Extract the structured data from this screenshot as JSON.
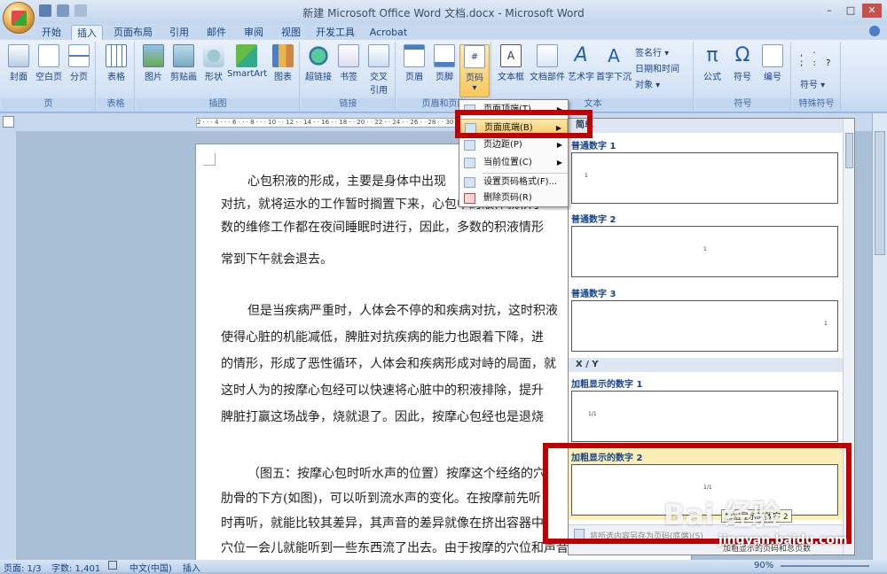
{
  "title": "新建 Microsoft Office Word 文档.docx - Microsoft Word",
  "tabs": [
    "开始",
    "插入",
    "页面布局",
    "引用",
    "邮件",
    "审阅",
    "视图",
    "开发工具",
    "Acrobat"
  ],
  "ribbon": {
    "groups": [
      "页",
      "表格",
      "插图",
      "链接",
      "页眉和页脚",
      "文本",
      "符号",
      "特殊符号"
    ],
    "buttons": {
      "cover": "封面",
      "blank": "空白页",
      "break": "分页",
      "table": "表格",
      "picture": "图片",
      "clipart": "剪贴画",
      "shapes": "形状",
      "smartart": "SmartArt",
      "chart": "图表",
      "hyperlink": "超链接",
      "bookmark": "书签",
      "crossref1": "交叉",
      "crossref2": "引用",
      "header": "页眉",
      "footer": "页脚",
      "pagenum": "页码",
      "textbox": "文本框",
      "quickparts": "文档部件",
      "wordart": "艺术字",
      "dropcap": "首字下沉",
      "signature": "签名行 ▾",
      "datetime": "日期和时间",
      "object": "对象 ▾",
      "formula": "公式",
      "symbol": "符号",
      "number": "编号",
      "symbols": "符号 ▾"
    }
  },
  "menu": {
    "items": [
      "页面顶端(T)",
      "页面底端(B)",
      "页边距(P)",
      "当前位置(C)",
      "设置页码格式(F)...",
      "删除页码(R)"
    ]
  },
  "gallery": {
    "heading": "简单",
    "items": [
      {
        "label": "普通数字 1",
        "num": "1"
      },
      {
        "label": "普通数字 2",
        "num": "1"
      },
      {
        "label": "普通数字 3",
        "num": "1"
      }
    ],
    "section2": "X / Y",
    "items2": [
      {
        "label": "加粗显示的数字 1",
        "num": "1/1"
      },
      {
        "label": "加粗显示的数字 2",
        "num": "1/1"
      }
    ],
    "tooltip": "加粗显示的数字 2",
    "footer_text": "将所选内容另存为页码(底端)(S)",
    "footer_hint": "加粗显示的页码和总页数"
  },
  "document": {
    "paragraphs": [
      "心包积液的形成，主要是身体中出现",
      "对抗，就将运水的工作暂时搁置下来，心包中的液体就积了",
      "数的维修工作都在夜间睡眠时进行，因此，多数的积液情形",
      "常到下午就会退去。",
      "但是当疾病严重时，人体会不停的和疾病对抗，这时积液",
      "使得心脏的机能减低，脾脏对抗疾病的能力也跟着下降，进",
      "的情形，形成了恶性循环，人体会和疾病形成对峙的局面，就",
      "这时人为的按摩心包经可以快速将心脏中的积液排除，提升",
      "脾脏打赢这场战争，烧就退了。因此，按摩心包经也是退烧",
      "（图五：按摩心包时听水声的位置）按摩这个经络的穴",
      "肋骨的下方(如图)，可以听到流水声的变化。在按摩前先听",
      "时再听，就能比较其差异，其声音的差异就像在挤出容器中",
      "穴位一会儿就能听到一些东西流了出去。由于按摩的穴位和声音的出处有一段"
    ]
  },
  "ruler_text": "2 · · · 4 · · · 6 · · · 8 · · · 10 · · 12 · · 14 · · 16 · · 18 · · 20 · · 22 · · 24 · · 26 · · 28 · · 30",
  "status": {
    "page": "页面: 1/3",
    "words": "字数: 1,401",
    "lang": "中文(中国)",
    "mode": "插入",
    "zoom": "90%"
  },
  "watermark": "Bai 经验",
  "watermark_url": "jingyan.baidu.com"
}
